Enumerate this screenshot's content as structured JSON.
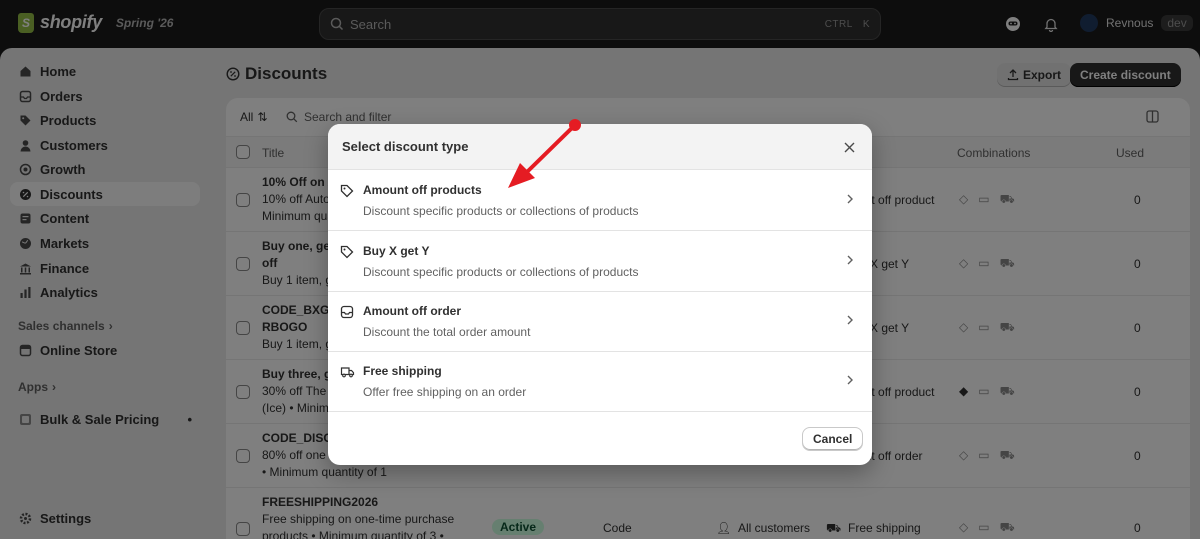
{
  "topbar": {
    "brand": "shopify",
    "season": "Spring '26",
    "search_placeholder": "Search",
    "shortcut_ctrl": "CTRL",
    "shortcut_key": "K",
    "user_name": "Revnous",
    "user_badge": "dev"
  },
  "sidebar": {
    "items": [
      {
        "label": "Home",
        "icon": "home-icon"
      },
      {
        "label": "Orders",
        "icon": "inbox-icon"
      },
      {
        "label": "Products",
        "icon": "tag-icon"
      },
      {
        "label": "Customers",
        "icon": "person-icon"
      },
      {
        "label": "Growth",
        "icon": "target-icon"
      },
      {
        "label": "Discounts",
        "icon": "discount-icon"
      },
      {
        "label": "Content",
        "icon": "content-icon"
      },
      {
        "label": "Markets",
        "icon": "globe-icon"
      },
      {
        "label": "Finance",
        "icon": "bank-icon"
      },
      {
        "label": "Analytics",
        "icon": "chart-icon"
      }
    ],
    "sales_channels_label": "Sales channels",
    "online_store_label": "Online Store",
    "apps_label": "Apps",
    "bulk_sale_label": "Bulk & Sale Pricing",
    "settings_label": "Settings"
  },
  "main": {
    "title": "Discounts",
    "export_label": "Export",
    "create_label": "Create discount",
    "filter_all": "All",
    "filter_placeholder": "Search and filter",
    "columns": {
      "title": "Title",
      "combinations": "Combinations",
      "used": "Used"
    },
    "rows": [
      {
        "line1": "10% Off on A",
        "line2": "10% off Auto",
        "line3": "Minimum quan",
        "right": "unt off product",
        "used": "0"
      },
      {
        "line1": "Buy one, get",
        "line2": "off",
        "line3": "Buy 1 item, g",
        "right": "X get Y",
        "used": "0"
      },
      {
        "line1": "CODE_BXGY",
        "line2": "RBOGO",
        "line3": "Buy 1 item, g",
        "right": "X get Y",
        "used": "0"
      },
      {
        "line1": "Buy three, g",
        "line2": "30% off The",
        "line3": "(Ice) • Minim",
        "right": "unt off product",
        "used": "0"
      },
      {
        "line1": "CODE_DISC",
        "line2": "80% off one",
        "line3": "• Minimum quantity of 1",
        "right": "unt off order",
        "used": "0"
      },
      {
        "line1": "FREESHIPPING2026",
        "line2": "Free shipping on one-time purchase",
        "line3": "products • Minimum quantity of 3 •",
        "status": "Active",
        "method": "Code",
        "eligibility": "All customers",
        "right": "Free shipping",
        "used": "0"
      }
    ]
  },
  "modal": {
    "title": "Select discount type",
    "options": [
      {
        "title": "Amount off products",
        "desc": "Discount specific products or collections of products",
        "icon": "tag-icon"
      },
      {
        "title": "Buy X get Y",
        "desc": "Discount specific products or collections of products",
        "icon": "tag-icon"
      },
      {
        "title": "Amount off order",
        "desc": "Discount the total order amount",
        "icon": "order-icon"
      },
      {
        "title": "Free shipping",
        "desc": "Offer free shipping on an order",
        "icon": "truck-icon"
      }
    ],
    "cancel_label": "Cancel"
  },
  "colors": {
    "accent": "#303030",
    "annotation": "#e51c23",
    "active_badge_bg": "#cdfee1"
  }
}
